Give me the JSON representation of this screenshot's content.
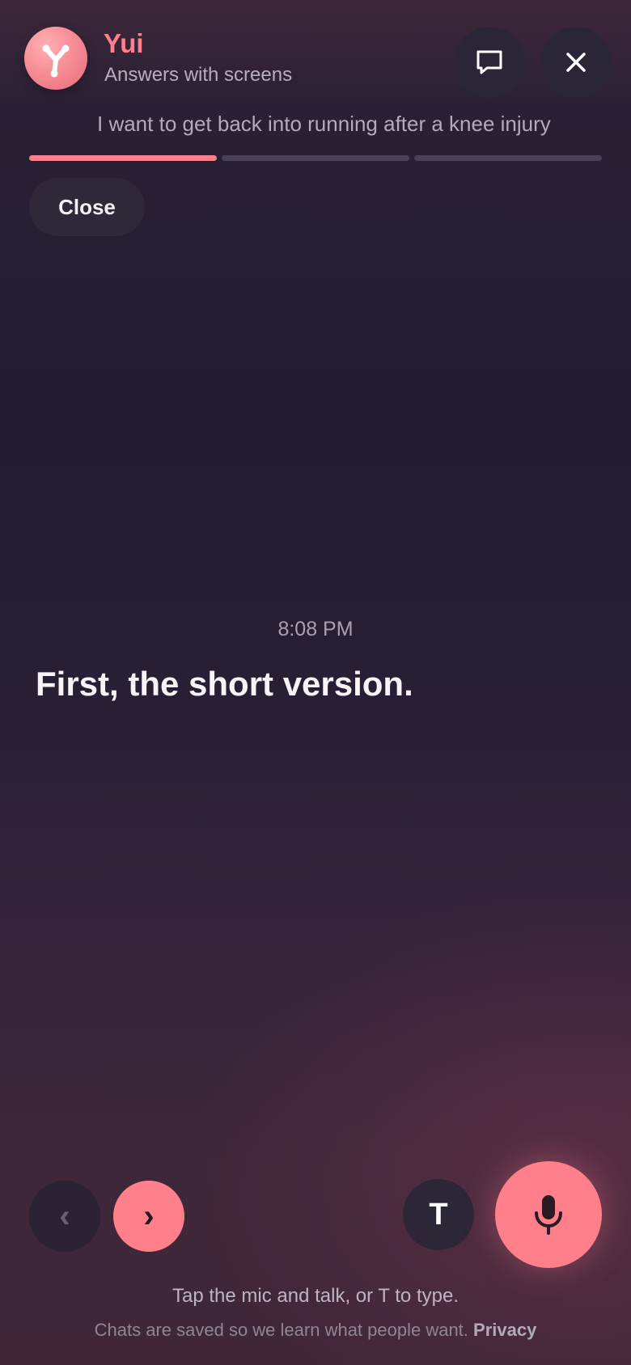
{
  "header": {
    "agent_name": "Yui",
    "agent_subtitle": "Answers with screens",
    "chat_icon": "chat-bubble-icon",
    "close_icon": "close-icon"
  },
  "prompt": {
    "text": "I want to get back into running after a knee injury"
  },
  "progress": {
    "total_steps": 3,
    "current_step": 1
  },
  "close_button": {
    "label": "Close"
  },
  "message": {
    "timestamp": "8:08 PM",
    "headline": "First, the short version."
  },
  "controls": {
    "prev_label": "‹",
    "next_label": "›",
    "type_label": "T",
    "mic_icon": "microphone-icon"
  },
  "footer": {
    "hint": "Tap the mic and talk, or T to type.",
    "privacy_text": "Chats are saved so we learn what people want.",
    "privacy_link": "Privacy"
  },
  "colors": {
    "accent": "#ff7f8a",
    "background": "#221d31",
    "button_dark": "#2c2637"
  }
}
